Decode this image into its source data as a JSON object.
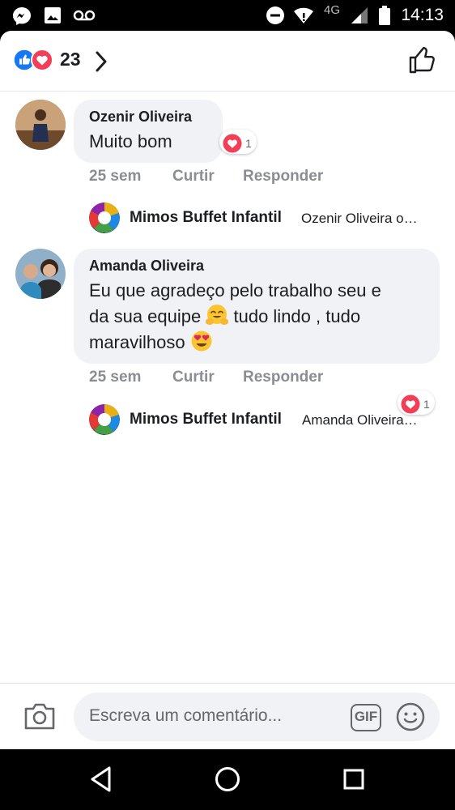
{
  "status_bar": {
    "time": "14:13",
    "network": "4G",
    "icons": [
      "messenger-icon",
      "image-icon",
      "voicemail-icon",
      "do-not-disturb-icon",
      "wifi-icon",
      "signal-icon",
      "battery-icon"
    ]
  },
  "header": {
    "reaction_icons": [
      "like-icon",
      "love-icon"
    ],
    "reaction_count": "23",
    "colors": {
      "like": "#1877f2",
      "love": "#f33e58"
    }
  },
  "comments": [
    {
      "author": "Ozenir Oliveira",
      "text": "Muito bom",
      "reaction_count": "1",
      "time": "25 sem",
      "like_label": "Curtir",
      "reply_label": "Responder",
      "reply": {
        "author": "Mimos Buffet Infantil",
        "preview": "Ozenir Oliveira o…"
      }
    },
    {
      "author": "Amanda Oliveira",
      "text_line1": "Eu que agradeço pelo trabalho seu e",
      "text_line2a": "da sua equipe",
      "text_line2b": "tudo lindo , tudo",
      "text_line3": "maravilhoso",
      "reaction_count": "1",
      "time": "25 sem",
      "like_label": "Curtir",
      "reply_label": "Responder",
      "reply": {
        "author": "Mimos Buffet Infantil",
        "preview": "Amanda Oliveira…"
      }
    }
  ],
  "composer": {
    "placeholder": "Escreva um comentário...",
    "gif_label": "GIF"
  },
  "nav_bar": {
    "icons": [
      "back-icon",
      "home-icon",
      "recents-icon"
    ]
  }
}
